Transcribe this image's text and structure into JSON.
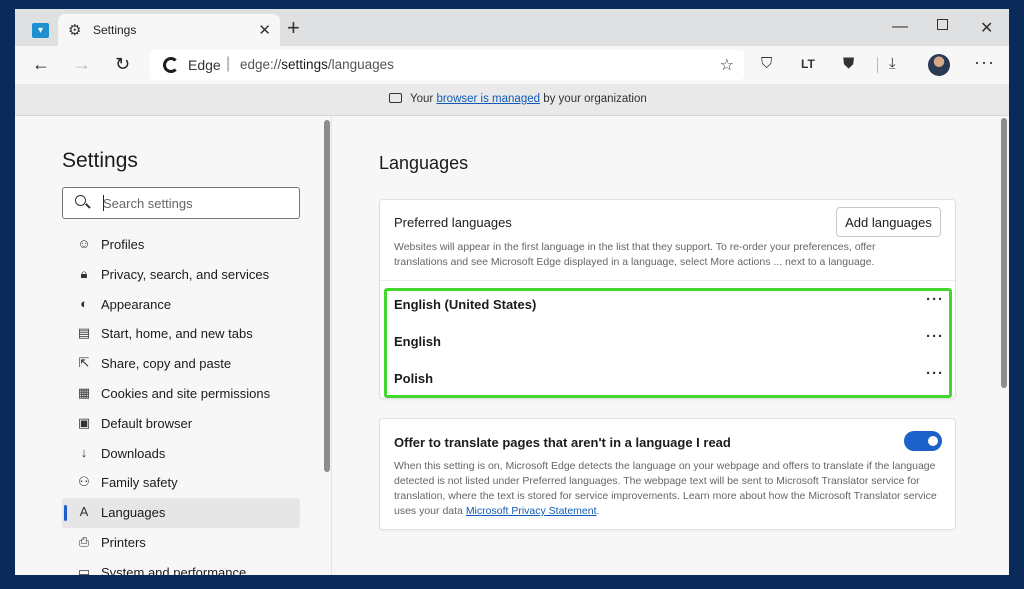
{
  "browser": {
    "tab_title": "Settings",
    "edge_label": "Edge",
    "url_scheme": "edge://",
    "url_path": "settings",
    "url_rest": "/languages",
    "managed_prefix": "Your",
    "managed_link": "browser is managed",
    "managed_suffix": "by your organization"
  },
  "sidebar": {
    "title": "Settings",
    "search_placeholder": "Search settings",
    "items": [
      {
        "label": "Profiles",
        "icon": "profile-icon"
      },
      {
        "label": "Privacy, search, and services",
        "icon": "lock-icon"
      },
      {
        "label": "Appearance",
        "icon": "appearance-icon"
      },
      {
        "label": "Start, home, and new tabs",
        "icon": "start-icon"
      },
      {
        "label": "Share, copy and paste",
        "icon": "share-icon"
      },
      {
        "label": "Cookies and site permissions",
        "icon": "cookies-icon"
      },
      {
        "label": "Default browser",
        "icon": "browser-icon"
      },
      {
        "label": "Downloads",
        "icon": "download-icon"
      },
      {
        "label": "Family safety",
        "icon": "family-icon"
      },
      {
        "label": "Languages",
        "icon": "language-icon"
      },
      {
        "label": "Printers",
        "icon": "printer-icon"
      },
      {
        "label": "System and performance",
        "icon": "system-icon"
      }
    ]
  },
  "main": {
    "title": "Languages",
    "preferred": {
      "title": "Preferred languages",
      "add_button": "Add languages",
      "description": "Websites will appear in the first language in the list that they support. To re-order your preferences, offer translations and see Microsoft Edge displayed in a language, select More actions ... next to a language.",
      "languages": [
        "English (United States)",
        "English",
        "Polish"
      ]
    },
    "translate": {
      "title": "Offer to translate pages that aren't in a language I read",
      "enabled": true,
      "description": "When this setting is on, Microsoft Edge detects the language on your webpage and offers to translate if the language detected is not listed under Preferred languages. The webpage text will be sent to Microsoft Translator service for translation, where the text is stored for service improvements. Learn more about how the Microsoft Translator service uses your data",
      "link": "Microsoft Privacy Statement",
      "link_suffix": "."
    }
  },
  "colors": {
    "accent": "#1b61c9",
    "highlight": "#41d72e",
    "link": "#0f5bb5"
  }
}
